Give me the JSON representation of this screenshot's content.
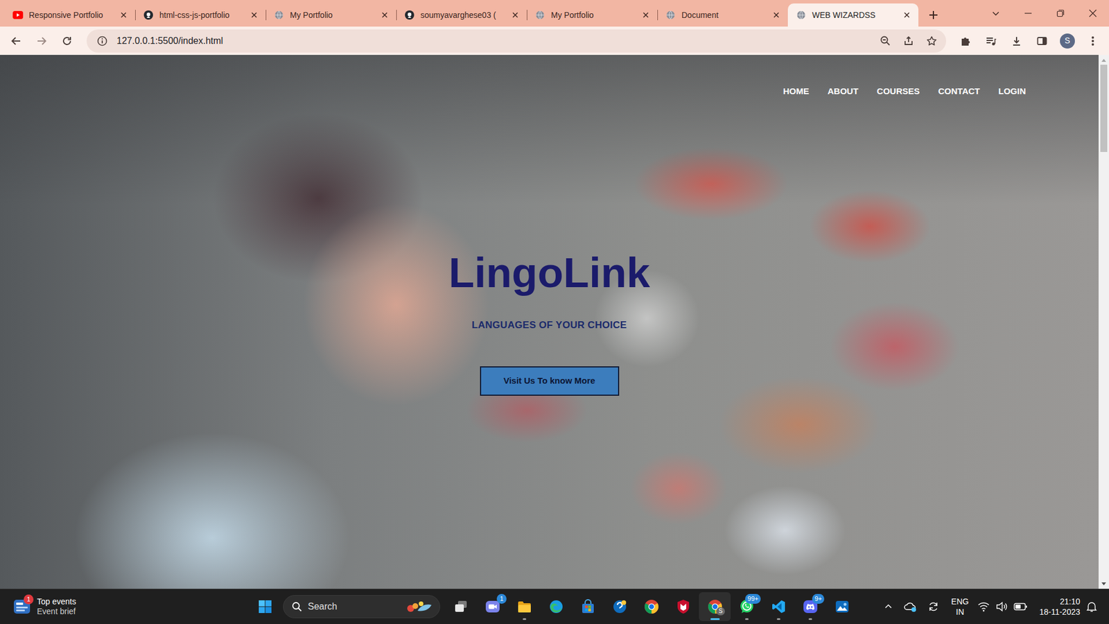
{
  "browser": {
    "tabs": [
      {
        "label": "Responsive Portfolio",
        "kind": "youtube",
        "selected": false
      },
      {
        "label": "html-css-js-portfolio",
        "kind": "github",
        "selected": false
      },
      {
        "label": "My Portfolio",
        "kind": "globe",
        "selected": false
      },
      {
        "label": "soumyavarghese03 (",
        "kind": "github",
        "selected": false
      },
      {
        "label": "My Portfolio",
        "kind": "globe",
        "selected": false
      },
      {
        "label": "Document",
        "kind": "globe",
        "selected": false
      },
      {
        "label": "WEB WIZARDSS",
        "kind": "globe",
        "selected": true
      }
    ],
    "address": "127.0.0.1:5500/index.html",
    "profile": "S"
  },
  "page": {
    "nav": [
      {
        "label": "HOME"
      },
      {
        "label": "ABOUT"
      },
      {
        "label": "COURSES"
      },
      {
        "label": "CONTACT"
      },
      {
        "label": "LOGIN"
      }
    ],
    "title": "LingoLink",
    "subtitle": "LANGUAGES OF YOUR CHOICE",
    "button": "Visit Us To know More",
    "scrollbar": {
      "level": 0.17
    }
  },
  "taskbar": {
    "widget": {
      "title": "Top events",
      "subtitle": "Event brief",
      "badge": "1"
    },
    "search": {
      "placeholder": "Search"
    },
    "apps": [
      {
        "kind": "taskview",
        "running": false,
        "selected": false
      },
      {
        "kind": "chat",
        "badge": "1",
        "running": false,
        "selected": false
      },
      {
        "kind": "explorer",
        "running": true,
        "selected": false
      },
      {
        "kind": "edge",
        "running": false,
        "selected": false
      },
      {
        "kind": "store",
        "running": false,
        "selected": false
      },
      {
        "kind": "help",
        "running": false,
        "selected": false
      },
      {
        "kind": "chrome",
        "running": false,
        "selected": false
      },
      {
        "kind": "mcafee",
        "running": false,
        "selected": false
      },
      {
        "kind": "chrome",
        "badge": "S",
        "running": true,
        "selected": true
      },
      {
        "kind": "whatsapp",
        "badge": "99+",
        "running": true,
        "selected": false
      },
      {
        "kind": "vscode",
        "running": true,
        "selected": false
      },
      {
        "kind": "discord",
        "badge": "9+",
        "running": true,
        "selected": false
      },
      {
        "kind": "photos",
        "running": false,
        "selected": false
      }
    ],
    "tray": {
      "language": "ENG",
      "region": "IN",
      "time": "21:10",
      "date": "18-11-2023"
    }
  }
}
